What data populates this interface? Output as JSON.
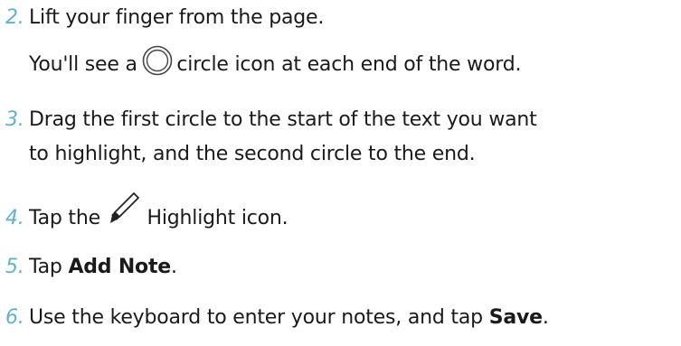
{
  "steps": [
    {
      "number": "2.",
      "text": "Lift your finger from the page.",
      "sub_before_icon": "You'll see a ",
      "sub_icon": "circle-icon",
      "sub_after_icon": " circle icon at each end of the word."
    },
    {
      "number": "3.",
      "line1": "Drag the first circle to the start of the text you want",
      "line2": "to highlight, and the second circle to the end."
    },
    {
      "number": "4.",
      "before_icon": "Tap the ",
      "icon": "highlighter-pen-icon",
      "after_icon": " Highlight icon."
    },
    {
      "number": "5.",
      "before_bold": "Tap ",
      "bold": "Add Note",
      "after_bold": "."
    },
    {
      "number": "6.",
      "before_bold": "Use the keyboard to enter your notes, and tap ",
      "bold": "Save",
      "after_bold": "."
    }
  ],
  "colors": {
    "step_number": "#5fb3c9",
    "text": "#1a1a1a",
    "background": "#ffffff"
  }
}
